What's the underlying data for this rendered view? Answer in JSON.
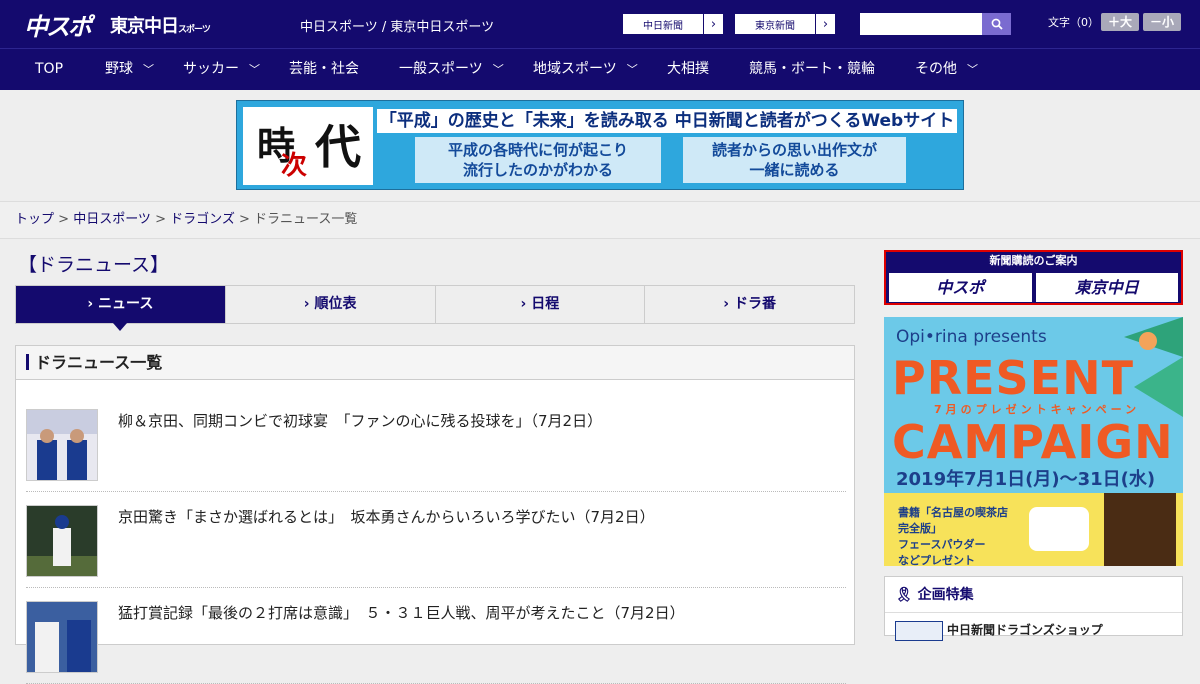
{
  "header": {
    "logo_chuspo": "中スポ",
    "logo_tokyo": "東京中日",
    "logo_tokyo_small": "スポーツ",
    "site_title": "中日スポーツ / 東京中日スポーツ",
    "link_chunichi": "中日新聞",
    "link_tokyo": "東京新聞",
    "search_placeholder": "",
    "font_label": "文字（0）",
    "font_plus": "＋大",
    "font_minus": "－小"
  },
  "nav": {
    "items": [
      "TOP",
      "野球",
      "サッカー",
      "芸能・社会",
      "一般スポーツ",
      "地域スポーツ",
      "大相撲",
      "競馬・ボート・競輪",
      "その他"
    ]
  },
  "banner": {
    "jidai": [
      "時",
      "次",
      "代"
    ],
    "headline": "「平成」の歴史と「未来」を読み取る 中日新聞と読者がつくるWebサイト",
    "box1_line1": "平成の各時代に何が起こり",
    "box1_line2": "流行したのかがわかる",
    "box2_line1": "読者からの思い出作文が",
    "box2_line2": "一緒に読める"
  },
  "breadcrumb": {
    "items": [
      "トップ",
      "中日スポーツ",
      "ドラゴンズ"
    ],
    "current": "ドラニュース一覧",
    "sep": " > "
  },
  "page_title": "【ドラニュース】",
  "tabs": [
    "ニュース",
    "順位表",
    "日程",
    "ドラ番"
  ],
  "panel_title": "ドラニュース一覧",
  "news": [
    {
      "title": "柳＆京田、同期コンビで初球宴　「ファンの心に残る投球を」（7月2日）"
    },
    {
      "title": "京田驚き「まさか選ばれるとは」　坂本勇さんからいろいろ学びたい（7月2日）"
    },
    {
      "title": "猛打賞記録「最後の２打席は意識」　５・３１巨人戦、周平が考えたこと（7月2日）"
    }
  ],
  "subscribe": {
    "title": "新聞購読のご案内",
    "logo1": "中スポ",
    "logo2": "東京中日"
  },
  "present": {
    "brand": "Opi•rina presents",
    "line1": "PRESENT",
    "sub": "7月のプレゼントキャンペーン",
    "line2": "CAMPAIGN",
    "date": "2019年7月1日(月)〜31日(水)",
    "b1": "書籍「名古屋の喫茶店",
    "b2": "完全版」",
    "b3": "フェースパウダー",
    "b4": "などプレゼント"
  },
  "kikaku": {
    "title": "企画特集",
    "row1": "中日新聞ドラゴンズショップ"
  }
}
